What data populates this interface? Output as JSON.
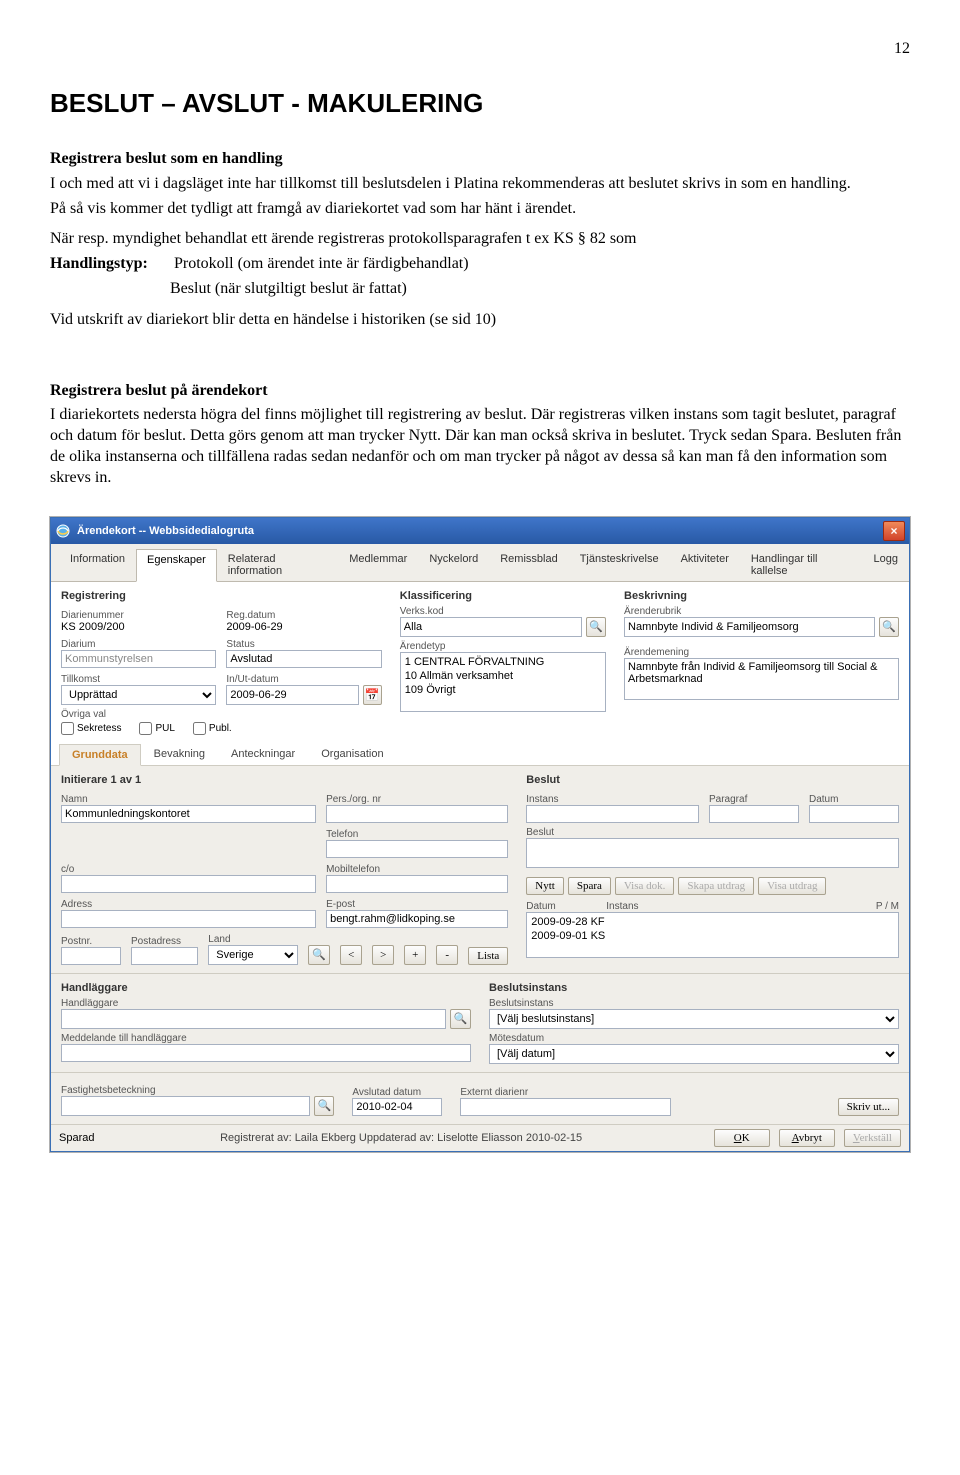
{
  "page_number": "12",
  "doc": {
    "title": "BESLUT – AVSLUT - MAKULERING",
    "h2_1": "Registrera beslut som en handling",
    "p1": "I och med att vi i dagsläget inte har tillkomst till beslutsdelen i Platina rekommenderas att beslutet skrivs in som en handling.",
    "p2": "På så vis kommer det tydligt att framgå av diariekortet vad som har hänt i ärendet.",
    "p3a": "När resp. myndighet behandlat ett ärende registreras protokollsparagrafen t ex KS § 82 som",
    "handlingstyp_key": "Handlingstyp:",
    "handlingstyp_val1": "Protokoll (om ärendet inte är färdigbehandlat)",
    "handlingstyp_val2": "Beslut (när slutgiltigt beslut är fattat)",
    "p4": "Vid utskrift av diariekort blir detta en händelse i historiken (se sid 10)",
    "h2_2": "Registrera beslut på ärendekort",
    "p5": "I diariekortets nedersta högra del finns möjlighet till registrering av beslut. Där registreras vilken instans som tagit beslutet, paragraf och datum för beslut. Detta görs genom att man trycker Nytt. Där kan man också skriva in beslutet. Tryck sedan Spara. Besluten från de olika instanserna och tillfällena radas sedan nedanför och om man trycker på något av dessa så kan man få den information som skrevs in."
  },
  "dialog": {
    "title": "Ärendekort -- Webbsidedialogruta",
    "close": "×",
    "tabs": [
      "Information",
      "Egenskaper",
      "Relaterad information",
      "Medlemmar",
      "Nyckelord",
      "Remissblad",
      "Tjänsteskrivelse",
      "Aktiviteter",
      "Handlingar till kallelse",
      "Logg"
    ],
    "subtabs": [
      "Grunddata",
      "Bevakning",
      "Anteckningar",
      "Organisation"
    ],
    "registrering": {
      "title": "Registrering",
      "diarienummer_label": "Diarienummer",
      "diarienummer_value": "KS 2009/200",
      "regdatum_label": "Reg.datum",
      "regdatum_value": "2009-06-29",
      "diarium_label": "Diarium",
      "diarium_value": "Kommunstyrelsen",
      "status_label": "Status",
      "status_value": "Avslutad",
      "tillkomst_label": "Tillkomst",
      "tillkomst_value": "Upprättad",
      "inut_label": "In/Ut-datum",
      "inut_value": "2009-06-29",
      "ovriga_label": "Övriga val",
      "sekretess": "Sekretess",
      "pul": "PUL",
      "publ": "Publ."
    },
    "klassificering": {
      "title": "Klassificering",
      "verkskod_label": "Verks.kod",
      "verkskod_value": "Alla",
      "arendetyp_label": "Ärendetyp",
      "typ1": "1 CENTRAL FÖRVALTNING",
      "typ2": "10 Allmän verksamhet",
      "typ3": "109 Övrigt"
    },
    "beskrivning": {
      "title": "Beskrivning",
      "rubrik_label": "Ärenderubrik",
      "rubrik_value": "Namnbyte Individ & Familjeomsorg",
      "mening_label": "Ärendemening",
      "mening_value": "Namnbyte från Individ & Familjeomsorg till Social & Arbetsmarknad"
    },
    "initierare": {
      "title": "Initierare 1 av 1",
      "namn_label": "Namn",
      "namn_value": "Kommunledningskontoret",
      "persorg_label": "Pers./org. nr",
      "telefon_label": "Telefon",
      "co_label": "c/o",
      "mobil_label": "Mobiltelefon",
      "adress_label": "Adress",
      "epost_label": "E-post",
      "epost_value": "bengt.rahm@lidkoping.se",
      "postnr_label": "Postnr.",
      "postadress_label": "Postadress",
      "land_label": "Land",
      "land_value": "Sverige",
      "btn_lt": "<",
      "btn_gt": ">",
      "btn_plus": "+",
      "btn_minus": "-",
      "btn_lista": "Lista"
    },
    "beslut": {
      "title": "Beslut",
      "instans_label": "Instans",
      "paragraf_label": "Paragraf",
      "datum_label": "Datum",
      "beslut_label": "Beslut",
      "btn_nytt": "Nytt",
      "btn_spara": "Spara",
      "btn_visadok": "Visa dok.",
      "btn_skapa": "Skapa utdrag",
      "btn_visaut": "Visa utdrag",
      "listhead_datum": "Datum",
      "listhead_instans": "Instans",
      "listhead_pm": "P / M",
      "row1": "2009-09-28 KF",
      "row2": "2009-09-01 KS"
    },
    "handlaggare": {
      "title": "Handläggare",
      "label": "Handläggare",
      "medd_label": "Meddelande till handläggare"
    },
    "beslutsinstans": {
      "title": "Beslutsinstans",
      "label": "Beslutsinstans",
      "value": "[Välj beslutsinstans]",
      "motes_label": "Mötesdatum",
      "motes_value": "[Välj datum]"
    },
    "fastighet": {
      "label": "Fastighetsbeteckning",
      "avslut_label": "Avslutad datum",
      "avslut_value": "2010-02-04",
      "externt_label": "Externt diarienr",
      "btn_skriv": "Skriv ut..."
    },
    "footer": {
      "sparad": "Sparad",
      "registrerat": "Registrerat av: Laila Ekberg  Uppdaterad av: Liselotte Eliasson  2010-02-15",
      "ok": "OK",
      "avbryt": "Avbryt",
      "verkstall": "Verkställ"
    }
  }
}
